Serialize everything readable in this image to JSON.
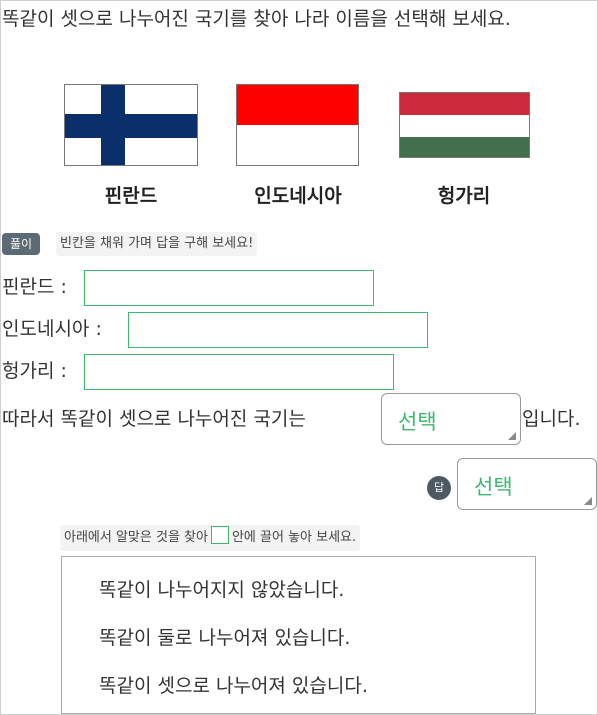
{
  "question": "똑같이 셋으로 나누어진 국기를 찾아 나라 이름을 선택해 보세요.",
  "flags": [
    {
      "name": "핀란드",
      "icon": "finland-flag-icon"
    },
    {
      "name": "인도네시아",
      "icon": "indonesia-flag-icon"
    },
    {
      "name": "헝가리",
      "icon": "hungary-flag-icon"
    }
  ],
  "solution": {
    "badge": "풀이",
    "hint": "빈칸을 채워 가며 답을 구해 보세요!",
    "rows": [
      {
        "label": "핀란드 :",
        "value": ""
      },
      {
        "label": "인도네시아 :",
        "value": ""
      },
      {
        "label": "헝가리 :",
        "value": ""
      }
    ],
    "sentence_prefix": "따라서 똑같이 셋으로 나누어진 국기는",
    "select_label": "선택",
    "sentence_suffix": "입니다."
  },
  "answer": {
    "badge": "답",
    "select_label": "선택"
  },
  "drag": {
    "hint_before": "아래에서 알맞은 것을 찾아",
    "hint_after": "안에 끌어 놓아 보세요.",
    "options": [
      "똑같이 나누어지지 않았습니다.",
      "똑같이 둘로 나누어져 있습니다.",
      "똑같이 셋으로 나누어져 있습니다."
    ]
  },
  "colors": {
    "accent": "#3cba6e",
    "finland_blue": "#0b2f6b",
    "indonesia_red": "#ff0000",
    "hungary_red": "#cd2a3e",
    "hungary_green": "#436f4d",
    "badge_gray": "#5c6b73"
  }
}
